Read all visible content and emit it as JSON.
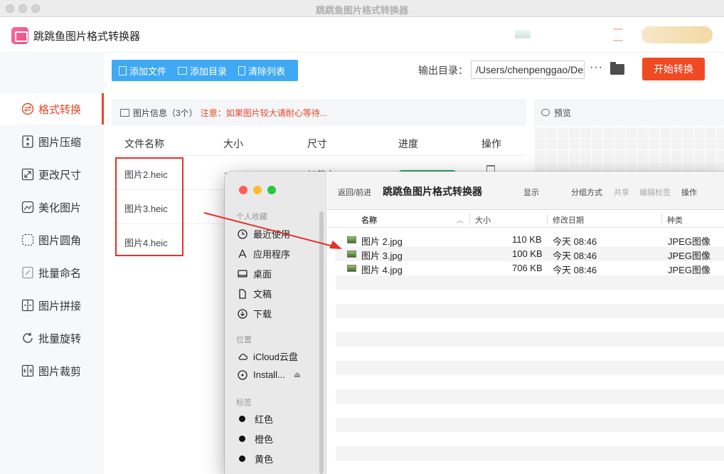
{
  "window": {
    "title": "跳跳鱼图片格式转换器"
  },
  "app": {
    "name": "跳跳鱼图片格式转换器"
  },
  "sidebar": {
    "items": [
      {
        "label": "格式转换",
        "icon": "format-convert-icon",
        "active": true
      },
      {
        "label": "图片压缩",
        "icon": "compress-icon"
      },
      {
        "label": "更改尺寸",
        "icon": "resize-icon"
      },
      {
        "label": "美化图片",
        "icon": "beautify-icon"
      },
      {
        "label": "图片圆角",
        "icon": "rounded-corner-icon"
      },
      {
        "label": "批量命名",
        "icon": "rename-icon"
      },
      {
        "label": "图片拼接",
        "icon": "stitch-icon"
      },
      {
        "label": "批量旋转",
        "icon": "rotate-icon"
      },
      {
        "label": "图片裁剪",
        "icon": "crop-icon"
      }
    ]
  },
  "toolbar": {
    "add_file": "添加文件",
    "add_dir": "添加目录",
    "clear_list": "清除列表",
    "output_label": "输出目录：",
    "output_path": "/Users/chenpenggao/Desktop",
    "more": "···",
    "start": "开始转换"
  },
  "info": {
    "count_label": "图片信息（3个）",
    "warning": "注意：如果图片较大请耐心等待..."
  },
  "table": {
    "headers": {
      "name": "文件名称",
      "size": "大小",
      "dimension": "尺寸",
      "progress": "进度",
      "action": "操作"
    },
    "rows": [
      {
        "name": "图片2.heic",
        "size": "-",
        "status": "加载中 0%"
      },
      {
        "name": "图片3.heic",
        "size": "",
        "status": ""
      },
      {
        "name": "图片4.heic",
        "size": "",
        "status": ""
      }
    ]
  },
  "preview": {
    "label": "预览"
  },
  "finder": {
    "nav": "返回/前进",
    "title": "跳跳鱼图片格式转换器",
    "toolbar": {
      "show": "显示",
      "group": "分组方式",
      "share": "共享",
      "edit_tags": "编辑标签",
      "action": "操作"
    },
    "sections": {
      "favorites": "个人收藏",
      "locations": "位置",
      "tags": "标签"
    },
    "favorites": [
      "最近使用",
      "应用程序",
      "桌面",
      "文稿",
      "下载"
    ],
    "locations": [
      "iCloud云盘",
      "Install..."
    ],
    "tags": [
      "红色",
      "橙色",
      "黄色"
    ],
    "columns": {
      "name": "名称",
      "size": "大小",
      "modified": "修改日期",
      "kind": "种类"
    },
    "files": [
      {
        "name": "图片 2.jpg",
        "size": "110 KB",
        "modified": "今天 08:46",
        "kind": "JPEG图像"
      },
      {
        "name": "图片 3.jpg",
        "size": "100 KB",
        "modified": "今天 08:46",
        "kind": "JPEG图像"
      },
      {
        "name": "图片 4.jpg",
        "size": "706 KB",
        "modified": "今天 08:46",
        "kind": "JPEG图像"
      }
    ]
  },
  "colors": {
    "accent": "#f04a23",
    "toolbar_blue": "#3fa9f5",
    "highlight_red": "#e8302a",
    "progress_green": "#21b26f"
  }
}
